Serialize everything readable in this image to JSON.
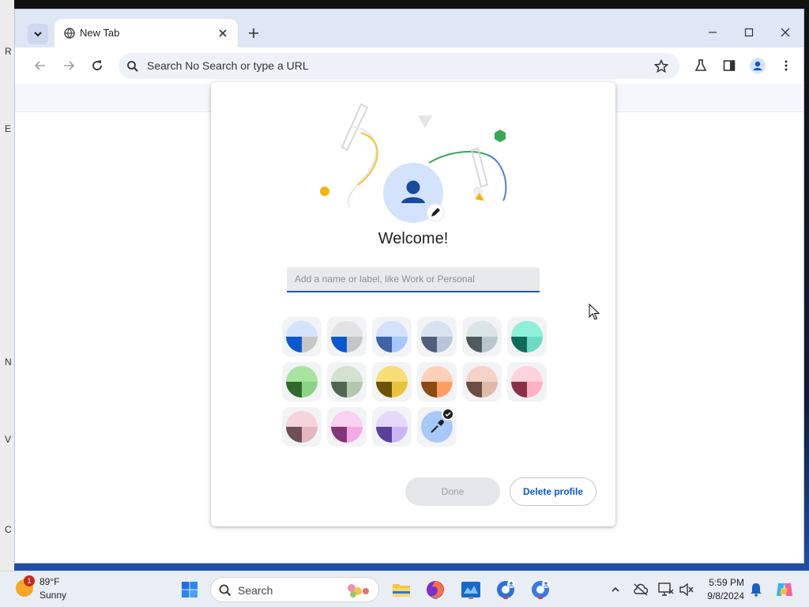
{
  "desktop": {
    "edge_letters": [
      "R",
      "E",
      "N",
      "V",
      "C"
    ]
  },
  "browser": {
    "tab": {
      "title": "New Tab"
    },
    "omnibox": {
      "text": "Search No Search or type a URL"
    }
  },
  "dialog": {
    "welcome": "Welcome!",
    "name_input": {
      "value": "",
      "placeholder": "Add a name or label, like Work or Personal"
    },
    "color_themes": [
      {
        "top": "#d3e3fd",
        "bl": "#0b57d0",
        "br": "#c4c7c5"
      },
      {
        "top": "#e3e3e3",
        "bl": "#0b57d0",
        "br": "#c4c7c5"
      },
      {
        "top": "#d3e3fd",
        "bl": "#3f63a6",
        "br": "#a8c7fa"
      },
      {
        "top": "#d9e2f1",
        "bl": "#4f5f7a",
        "br": "#b7c4d9"
      },
      {
        "top": "#dbe4e6",
        "bl": "#4f5b5e",
        "br": "#b9c7ca"
      },
      {
        "top": "#8ef0d8",
        "bl": "#0f6b5a",
        "br": "#6fd9c2"
      },
      {
        "top": "#a9e3a0",
        "bl": "#2f6a2c",
        "br": "#8dd386"
      },
      {
        "top": "#d2e1d0",
        "bl": "#506650",
        "br": "#b3c7b0"
      },
      {
        "top": "#f7dd73",
        "bl": "#6b5400",
        "br": "#e8c43e"
      },
      {
        "top": "#ffd0b8",
        "bl": "#8a4a14",
        "br": "#ff9e62"
      },
      {
        "top": "#f4d3c6",
        "bl": "#6b4c41",
        "br": "#dfb9aa"
      },
      {
        "top": "#ffd3dd",
        "bl": "#8b3047",
        "br": "#ffb0c2"
      },
      {
        "top": "#f5d3db",
        "bl": "#6e4f56",
        "br": "#e3b6c1"
      },
      {
        "top": "#fbd0f0",
        "bl": "#84357a",
        "br": "#f6a8e4"
      },
      {
        "top": "#e6d8fb",
        "bl": "#5b3f9c",
        "br": "#cbb5f5"
      }
    ],
    "done_label": "Done",
    "delete_label": "Delete profile"
  },
  "taskbar": {
    "weather": {
      "temp": "89°F",
      "desc": "Sunny",
      "badge": "1"
    },
    "search_label": "Search",
    "time": "5:59 PM",
    "date": "9/8/2024"
  }
}
